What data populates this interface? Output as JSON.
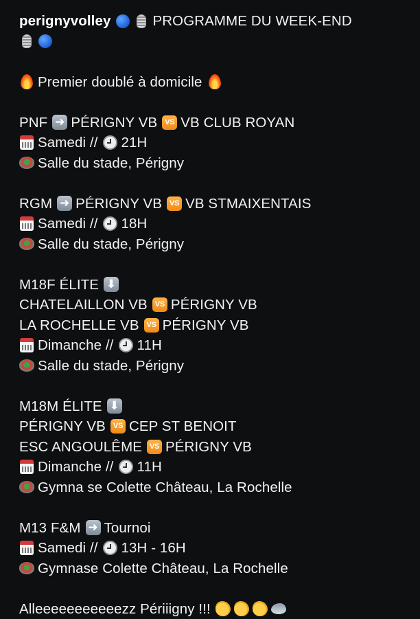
{
  "post": {
    "username": "perignyvolley",
    "header_text": "PROGRAMME DU WEEK-END",
    "headline": "Premier doublé à domicile",
    "blocks": [
      {
        "team": "PNF",
        "home": "PÉRIGNY VB",
        "away": "VB CLUB ROYAN",
        "date": "Samedi //",
        "time": "21H",
        "venue": "Salle du stade, Périgny"
      },
      {
        "team": "RGM",
        "home": "PÉRIGNY VB",
        "away": "VB STMAIXENTAIS",
        "date": "Samedi //",
        "time": "18H",
        "venue": "Salle du stade, Périgny"
      }
    ],
    "m18f": {
      "team": "M18F ÉLITE",
      "match1_home": "CHATELAILLON VB",
      "match1_away": "PÉRIGNY VB",
      "match2_home": "LA ROCHELLE VB",
      "match2_away": "PÉRIGNY VB",
      "date": "Dimanche //",
      "time": "11H",
      "venue": "Salle du stade, Périgny"
    },
    "m18m": {
      "team": "M18M ÉLITE",
      "match1_home": "PÉRIGNY VB",
      "match1_away": "CEP ST BENOIT",
      "match2_home": "ESC ANGOULÊME",
      "match2_away": "PÉRIGNY VB",
      "date": "Dimanche //",
      "time": "11H",
      "venue": "Gymna se Colette Château, La Rochelle"
    },
    "m13": {
      "team": "M13 F&M",
      "event": "Tournoi",
      "date": "Samedi //",
      "time": "13H - 16H",
      "venue": "Gymnase Colette Château, La Rochelle"
    },
    "closing": "Alleeeeeeeeeeezz Périiigny !!!",
    "vs_label": "VS",
    "icons": [
      "blue-circle-icon",
      "microphone-icon",
      "fire-icon",
      "right-arrow-icon",
      "down-arrow-icon",
      "vs-icon",
      "calendar-icon",
      "clock-icon",
      "stadium-icon",
      "clapping-hands-icon",
      "shark-icon"
    ]
  }
}
